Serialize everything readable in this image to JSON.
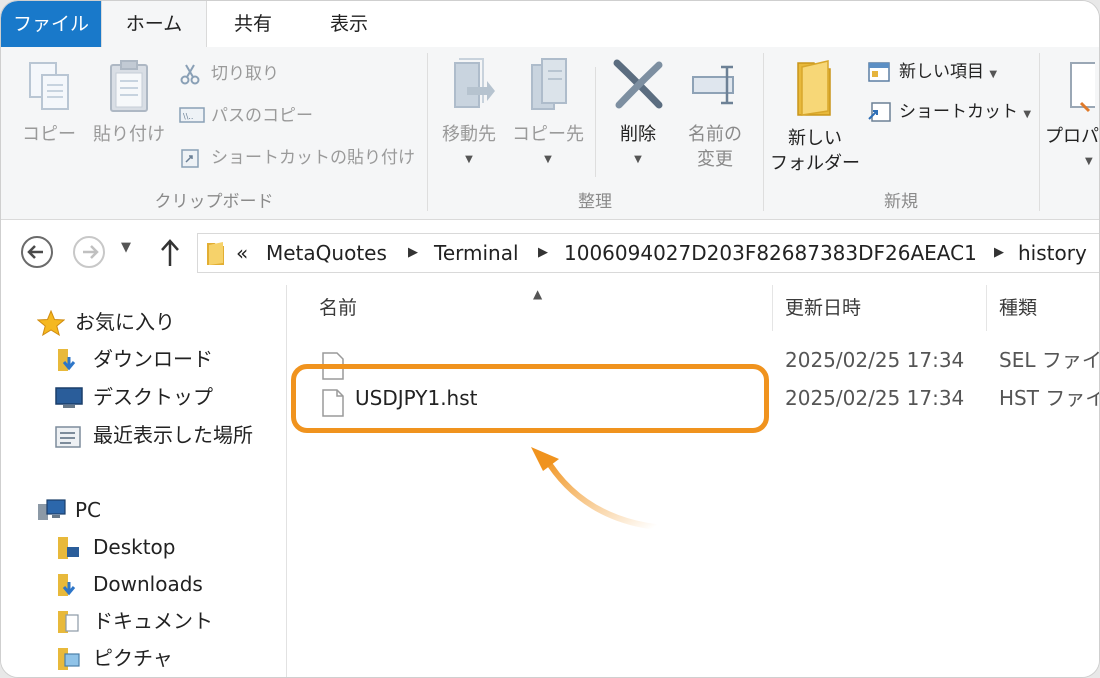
{
  "tabs": {
    "file": "ファイル",
    "home": "ホーム",
    "share": "共有",
    "view": "表示"
  },
  "ribbon": {
    "clipboard": {
      "copy": "コピー",
      "paste": "貼り付け",
      "cut": "切り取り",
      "copy_path": "パスのコピー",
      "paste_shortcut": "ショートカットの貼り付け",
      "label": "クリップボード"
    },
    "organize": {
      "move_to": "移動先",
      "copy_to": "コピー先",
      "delete": "削除",
      "rename_line1": "名前の",
      "rename_line2": "変更",
      "label": "整理"
    },
    "new": {
      "new_folder_line1": "新しい",
      "new_folder_line2": "フォルダー",
      "new_item": "新しい項目",
      "shortcut": "ショートカット",
      "label": "新規"
    },
    "open": {
      "properties": "プロパ"
    }
  },
  "address": {
    "prefix": "«",
    "crumbs": [
      "MetaQuotes",
      "Terminal",
      "1006094027D203F82687383DF26AEAC1",
      "history"
    ]
  },
  "navpane": {
    "quick_access": "お気に入り",
    "downloads_jp": "ダウンロード",
    "desktop_jp": "デスクトップ",
    "recent": "最近表示した場所",
    "pc": "PC",
    "desktop": "Desktop",
    "downloads": "Downloads",
    "documents": "ドキュメント",
    "pictures": "ピクチャ"
  },
  "columns": {
    "name": "名前",
    "modified": "更新日時",
    "type": "種類"
  },
  "files": [
    {
      "name": "",
      "modified": "2025/02/25 17:34",
      "type": "SEL ファイル"
    },
    {
      "name": "USDJPY1.hst",
      "modified": "2025/02/25 17:34",
      "type": "HST ファイル"
    }
  ],
  "colors": {
    "accent": "#1979ca",
    "highlight": "#f0931e"
  }
}
